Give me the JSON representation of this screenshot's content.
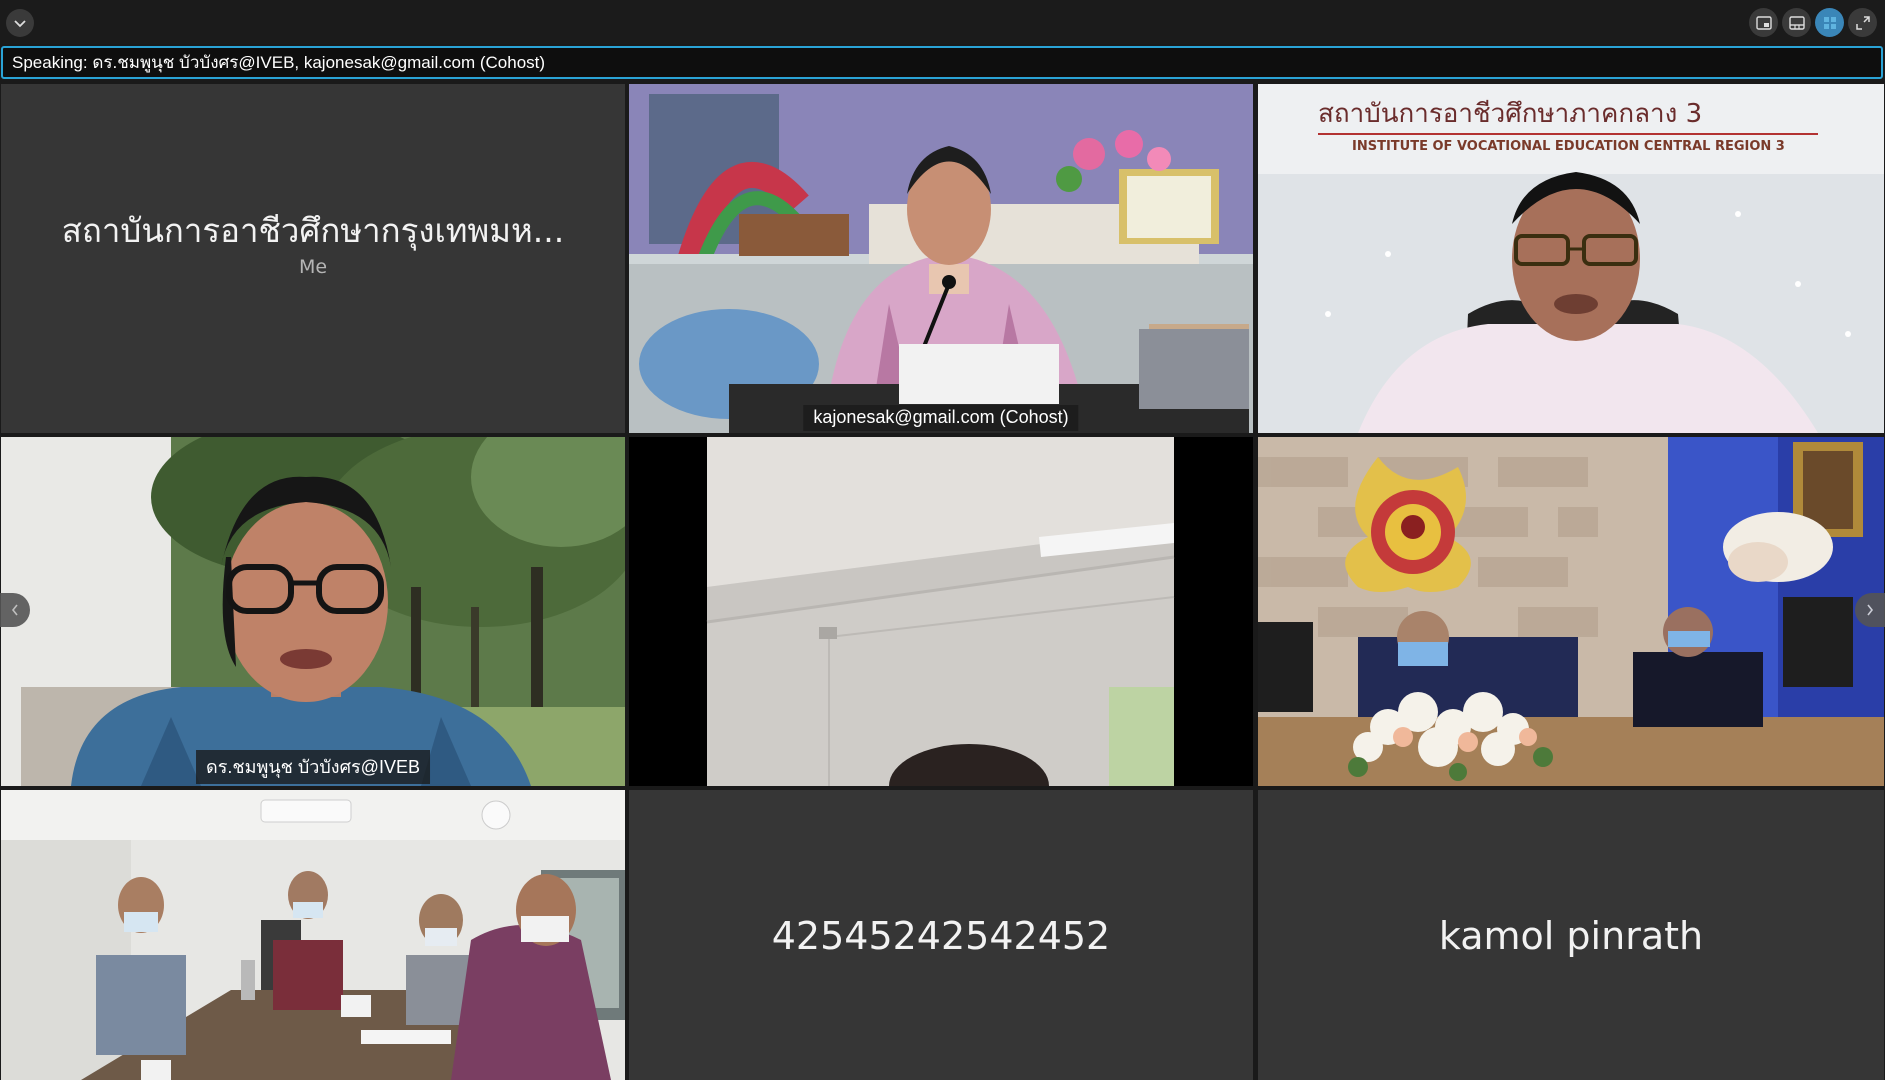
{
  "speaking_bar": {
    "text": "Speaking: ดร.ชมพูนุช บัวบังศร@IVEB, kajonesak@gmail.com (Cohost)"
  },
  "tiles": {
    "self": {
      "name": "สถาบันการอาชีวศึกษากรุงเทพมหานคร",
      "name_display": "สถาบันการอาชีวศึกษากรุงเทพมห...",
      "subtitle": "Me"
    },
    "cohost": {
      "label": "kajonesak@gmail.com (Cohost)"
    },
    "region3": {
      "sign_th": "สถาบันการอาชีวศึกษาภาคกลาง 3",
      "sign_en": "INSTITUTE OF VOCATIONAL EDUCATION CENTRAL REGION 3"
    },
    "iveb": {
      "label": "ดร.ชมพูนุช บัวบังศร@IVEB"
    },
    "phone_participant": {
      "name": "42545242542452"
    },
    "kamol": {
      "name": "kamol pinrath"
    }
  },
  "icons": [
    "chevron-down-icon",
    "pip-view-icon",
    "filmstrip-view-icon",
    "gallery-view-icon",
    "fullscreen-icon",
    "chevron-left-icon",
    "chevron-right-icon"
  ],
  "colors": {
    "accent": "#2aa3d6",
    "tile_bg": "#363636",
    "app_bg": "#1a1a1a"
  }
}
